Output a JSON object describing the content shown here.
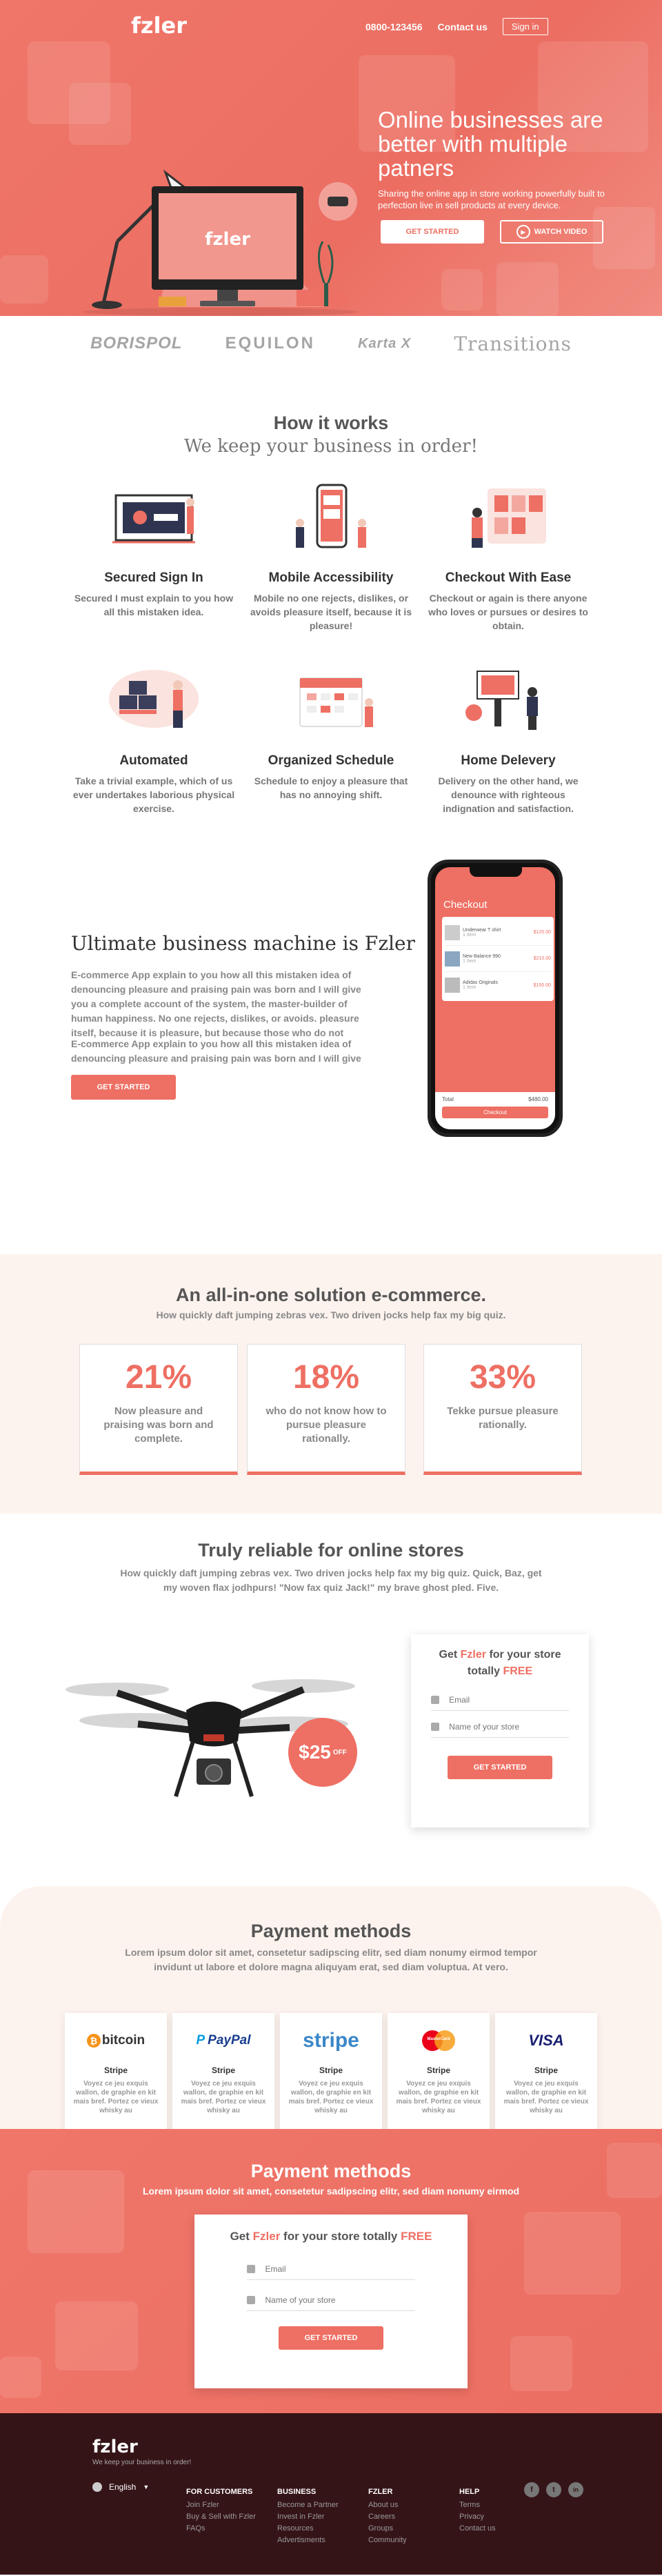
{
  "header": {
    "logo": "fzler",
    "phone": "0800-123456",
    "contact": "Contact us",
    "signin": "Sign in"
  },
  "hero": {
    "title": "Online businesses are better with multiple patners",
    "subtitle": "Sharing the online app in store working powerfully built to perfection live in sell products at every device.",
    "cta_primary": "GET STARTED",
    "cta_video": "WATCH VIDEO",
    "monitor_logo": "fzler"
  },
  "brands": [
    "BORISPOL",
    "EQUILON",
    "Karta X",
    "Transitions"
  ],
  "how": {
    "title": "How it works",
    "tagline": "We keep your business in order!",
    "features": [
      {
        "title": "Secured Sign In",
        "text": "Secured I must explain to you how all this mistaken idea."
      },
      {
        "title": "Mobile Accessibility",
        "text": "Mobile no one rejects, dislikes, or avoids pleasure itself, because it is pleasure!"
      },
      {
        "title": "Checkout With Ease",
        "text": "Checkout or again is there anyone who loves or pursues or desires to obtain."
      },
      {
        "title": "Automated",
        "text": "Take a trivial example, which of us ever undertakes laborious physical exercise."
      },
      {
        "title": "Organized Schedule",
        "text": "Schedule to enjoy a pleasure that has no annoying shift."
      },
      {
        "title": "Home Delevery",
        "text": "Delivery on the other hand, we denounce with righteous indignation and satisfaction."
      }
    ]
  },
  "ultimate": {
    "title": "Ultimate business machine is Fzler",
    "para1": "E-commerce App explain to you how all this mistaken idea of denouncing pleasure and praising pain was born and I will give you a complete account of the system, the master-builder of human happiness. No one rejects, dislikes, or avoids. pleasure itself, because it is pleasure, but because those who do not",
    "para2": "E-commerce App explain to you how all this mistaken idea of denouncing pleasure and praising pain was born and I will give",
    "cta": "GET STARTED",
    "phone": {
      "heading": "Checkout",
      "items": [
        {
          "name": "Underwear T shirt",
          "price": "$120.00",
          "qty": "1 Item"
        },
        {
          "name": "New Balance 990",
          "price": "$210.00",
          "qty": "1 Item"
        },
        {
          "name": "Adidas Originals",
          "price": "$150.00",
          "qty": "1 Item"
        }
      ],
      "total_label": "Total",
      "total_value": "$480.00",
      "checkout_btn": "Checkout"
    }
  },
  "stats": {
    "title": "An all-in-one solution e-commerce.",
    "subtitle": "How quickly daft jumping zebras vex. Two driven jocks help fax my big quiz.",
    "items": [
      {
        "value": "21%",
        "text": "Now pleasure and praising was born and  complete."
      },
      {
        "value": "18%",
        "text": "who do not know how to pursue pleasure rationally."
      },
      {
        "value": "33%",
        "text": "Tekke pursue pleasure rationally."
      }
    ]
  },
  "reliable": {
    "title": "Truly reliable for online stores",
    "subtitle": "How quickly daft jumping zebras vex. Two driven jocks help fax my big quiz. Quick, Baz, get my woven flax jodhpurs! \"Now fax quiz Jack!\" my brave ghost pled. Five.",
    "price": "$25",
    "price_suffix": "OFF",
    "form": {
      "title_pre": "Get ",
      "title_brand": "Fzler",
      "title_mid": " for your store totally ",
      "title_free": "FREE",
      "email_placeholder": "Email",
      "store_placeholder": "Name of your store",
      "button": "GET STARTED"
    }
  },
  "payment": {
    "title": "Payment methods",
    "subtitle": "Lorem ipsum dolor sit amet, consetetur sadipscing elitr, sed diam nonumy eirmod tempor invidunt ut labore et dolore magna aliquyam erat, sed diam voluptua. At vero.",
    "methods": [
      {
        "logo": "bitcoin",
        "name": "Stripe",
        "text": "Voyez ce jeu exquis wallon, de graphie en kit mais bref. Portez ce vieux whisky au"
      },
      {
        "logo": "PayPal",
        "name": "Stripe",
        "text": "Voyez ce jeu exquis wallon, de graphie en kit mais bref. Portez ce vieux whisky au"
      },
      {
        "logo": "stripe",
        "name": "Stripe",
        "text": "Voyez ce jeu exquis wallon, de graphie en kit mais bref. Portez ce vieux whisky au"
      },
      {
        "logo": "MasterCard",
        "name": "Stripe",
        "text": "Voyez ce jeu exquis wallon, de graphie en kit mais bref. Portez ce vieux whisky au"
      },
      {
        "logo": "VISA",
        "name": "Stripe",
        "text": "Voyez ce jeu exquis wallon, de graphie en kit mais bref. Portez ce vieux whisky au"
      }
    ]
  },
  "payment2": {
    "title": "Payment methods",
    "subtitle": "Lorem ipsum dolor sit amet, consetetur sadipscing elitr, sed diam nonumy eirmod",
    "form": {
      "title_pre": "Get ",
      "title_brand": "Fzler",
      "title_mid": " for your store totally ",
      "title_free": "FREE",
      "email_placeholder": "Email",
      "store_placeholder": "Name of your store",
      "button": "GET STARTED"
    }
  },
  "footer": {
    "logo": "fzler",
    "tagline": "We keep your business in order!",
    "language": "English",
    "columns": [
      {
        "title": "FOR CUSTOMERS",
        "links": [
          "Join Fzler",
          "Buy & Sell with Fzler",
          "FAQs"
        ]
      },
      {
        "title": "BUSINESS",
        "links": [
          "Become a Partner",
          "Invest in Fzler",
          "Resources",
          "Advertisments"
        ]
      },
      {
        "title": "FZLER",
        "links": [
          "About us",
          "Careers",
          "Groups",
          "Community"
        ]
      },
      {
        "title": "HELP",
        "links": [
          "Terms",
          "Privacy",
          "Contact us"
        ]
      }
    ],
    "social": [
      "f",
      "t",
      "in"
    ]
  },
  "colors": {
    "accent": "#ee6f63",
    "footer_bg": "#351418",
    "soft_bg": "#fdf3ee"
  }
}
